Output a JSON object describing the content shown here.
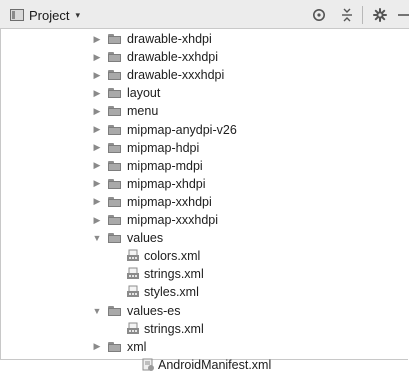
{
  "toolbar": {
    "title": "Project",
    "caret": "▾",
    "icons": [
      "target-icon",
      "collapse-all-icon",
      "gear-icon",
      "hide-icon"
    ]
  },
  "tree": [
    {
      "label": "drawable-xhdpi",
      "type": "folder",
      "state": "collapsed",
      "depth": 1
    },
    {
      "label": "drawable-xxhdpi",
      "type": "folder",
      "state": "collapsed",
      "depth": 1
    },
    {
      "label": "drawable-xxxhdpi",
      "type": "folder",
      "state": "collapsed",
      "depth": 1
    },
    {
      "label": "layout",
      "type": "folder",
      "state": "collapsed",
      "depth": 1
    },
    {
      "label": "menu",
      "type": "folder",
      "state": "collapsed",
      "depth": 1
    },
    {
      "label": "mipmap-anydpi-v26",
      "type": "folder",
      "state": "collapsed",
      "depth": 1
    },
    {
      "label": "mipmap-hdpi",
      "type": "folder",
      "state": "collapsed",
      "depth": 1
    },
    {
      "label": "mipmap-mdpi",
      "type": "folder",
      "state": "collapsed",
      "depth": 1
    },
    {
      "label": "mipmap-xhdpi",
      "type": "folder",
      "state": "collapsed",
      "depth": 1
    },
    {
      "label": "mipmap-xxhdpi",
      "type": "folder",
      "state": "collapsed",
      "depth": 1
    },
    {
      "label": "mipmap-xxxhdpi",
      "type": "folder",
      "state": "collapsed",
      "depth": 1
    },
    {
      "label": "values",
      "type": "folder",
      "state": "expanded",
      "depth": 1
    },
    {
      "label": "colors.xml",
      "type": "xml",
      "depth": 2
    },
    {
      "label": "strings.xml",
      "type": "xml",
      "depth": 2
    },
    {
      "label": "styles.xml",
      "type": "xml",
      "depth": 2
    },
    {
      "label": "values-es",
      "type": "folder",
      "state": "expanded",
      "depth": 1
    },
    {
      "label": "strings.xml",
      "type": "xml",
      "depth": 2
    },
    {
      "label": "xml",
      "type": "folder",
      "state": "collapsed",
      "depth": 1
    },
    {
      "label": "AndroidManifest.xml",
      "type": "manifest",
      "depth": 0
    }
  ]
}
